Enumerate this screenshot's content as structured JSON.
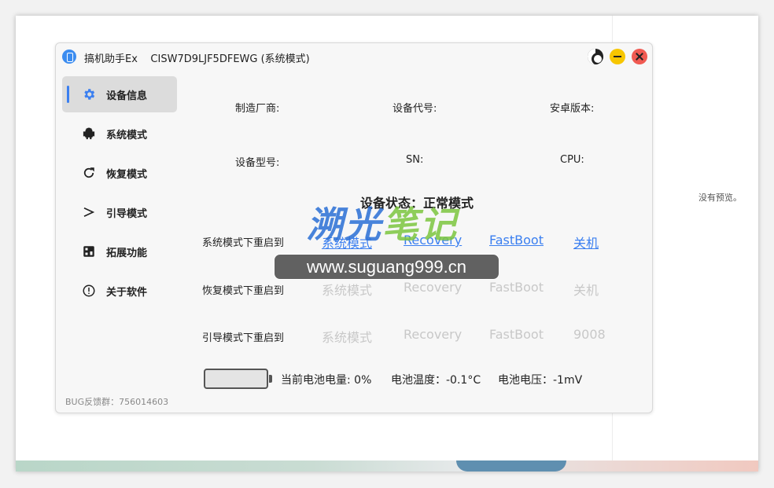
{
  "app": {
    "title": "搞机助手Ex    CISW7D9LJF5DFEWG (系统模式)"
  },
  "sidebar": {
    "items": [
      {
        "label": "设备信息",
        "icon": "gear-icon",
        "active": true
      },
      {
        "label": "系统模式",
        "icon": "android-icon"
      },
      {
        "label": "恢复模式",
        "icon": "refresh-icon"
      },
      {
        "label": "引导模式",
        "icon": "chevron-right-icon"
      },
      {
        "label": "拓展功能",
        "icon": "grid-icon"
      },
      {
        "label": "关于软件",
        "icon": "info-icon"
      }
    ],
    "bug_text": "BUG反馈群：756014603"
  },
  "device_info": {
    "manufacturer": "制造厂商:",
    "codename": "设备代号:",
    "android_version": "安卓版本:",
    "model": "设备型号:",
    "sn": "SN:",
    "cpu": "CPU:"
  },
  "status": "设备状态：正常模式",
  "reboot": {
    "rows": [
      {
        "label": "系统模式下重启到",
        "options": [
          "系统模式",
          "Recovery",
          "FastBoot",
          "关机"
        ]
      },
      {
        "label": "恢复模式下重启到",
        "options": [
          "系统模式",
          "Recovery",
          "FastBoot",
          "关机"
        ]
      },
      {
        "label": "引导模式下重启到",
        "options": [
          "系统模式",
          "Recovery",
          "FastBoot",
          "9008"
        ]
      }
    ]
  },
  "battery": {
    "level_text": "当前电池电量: 0%",
    "temp_text": "电池温度：-0.1°C",
    "voltage_text": "电池电压：-1mV",
    "level": 0
  },
  "side_panel": {
    "no_preview": "没有预览。"
  },
  "watermark": {
    "title_blue": "溯光",
    "title_green": "笔记",
    "url": "www.suguang999.cn"
  },
  "colors": {
    "accent": "#3b7ff0",
    "disabled": "#c8c8c8",
    "minimize": "#f7c600",
    "close": "#f05a52"
  }
}
